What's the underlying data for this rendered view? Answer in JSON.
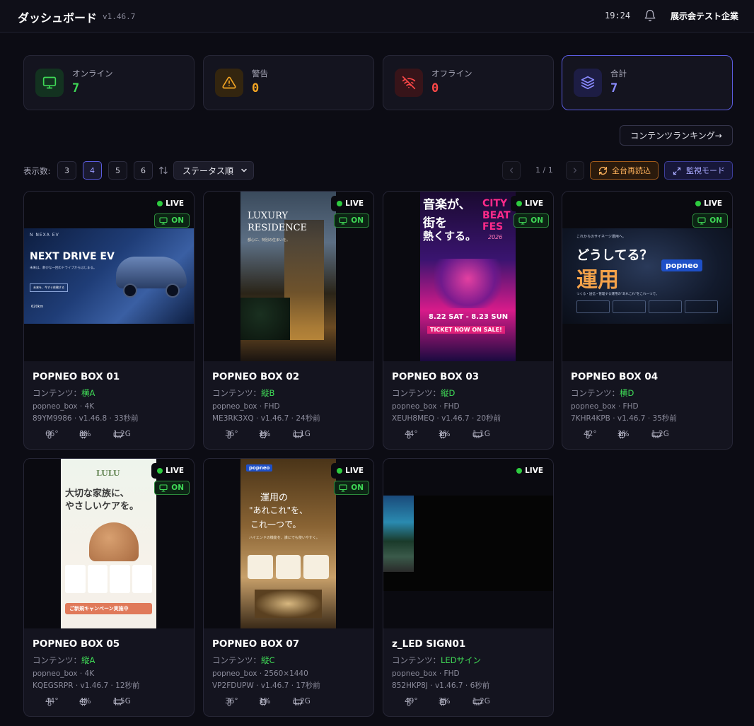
{
  "header": {
    "title": "ダッシュボード",
    "version": "v1.46.7",
    "time": "19:24",
    "org": "展示会テスト企業"
  },
  "stats": [
    {
      "label": "オンライン",
      "value": "7",
      "color": "#3fd956",
      "icon": "monitor-icon"
    },
    {
      "label": "警告",
      "value": "0",
      "color": "#f5a623",
      "icon": "warning-icon"
    },
    {
      "label": "オフライン",
      "value": "0",
      "color": "#ff4848",
      "icon": "wifi-off-icon"
    },
    {
      "label": "合計",
      "value": "7",
      "color": "#8a8bff",
      "icon": "layers-icon"
    }
  ],
  "ranking_button": "コンテンツランキング→",
  "controls": {
    "display_count_label": "表示数:",
    "counts": [
      "3",
      "4",
      "5",
      "6"
    ],
    "selected_count": "4",
    "sort_value": "ステータス順",
    "page": "1 / 1",
    "reload_label": "全台再読込",
    "monitor_label": "監視モード"
  },
  "status": {
    "live": "LIVE",
    "on": "ON"
  },
  "content_prefix": "コンテンツ：",
  "devices": [
    {
      "name": "POPNEO BOX 01",
      "content": "横A",
      "model": "popneo_box",
      "resolution": "4K",
      "serial": "89YM9986",
      "version": "v1.46.8",
      "last_seen": "33秒前",
      "temp": "66°",
      "cpu": "8%",
      "mem": "1.2G",
      "on": true,
      "poster": {
        "brand": "N NEXA EV",
        "headline": "NEXT DRIVE EV",
        "sub": "未来は、静かな一回のドライブからはじまる。",
        "cta": "未来を、今すぐ体験する",
        "spec": "620km"
      }
    },
    {
      "name": "POPNEO BOX 02",
      "content": "縦B",
      "model": "popneo_box",
      "resolution": "FHD",
      "serial": "ME3RK3XQ",
      "version": "v1.46.7",
      "last_seen": "24秒前",
      "temp": "36°",
      "cpu": "1%",
      "mem": "1.1G",
      "on": true,
      "poster": {
        "line1": "LUXURY",
        "line2": "RESIDENCE",
        "sub": "都心に、特別の住まいを。"
      }
    },
    {
      "name": "POPNEO BOX 03",
      "content": "縦D",
      "model": "popneo_box",
      "resolution": "FHD",
      "serial": "XEUH8MEQ",
      "version": "v1.46.7",
      "last_seen": "20秒前",
      "temp": "44°",
      "cpu": "1%",
      "mem": "1.1G",
      "on": true,
      "poster": {
        "jp1": "音楽が、",
        "jp2": "街を",
        "jp3": "熱くする。",
        "city1": "CITY",
        "city2": "BEAT",
        "city3": "FES",
        "year": "2026",
        "dates": "8.22 SAT - 8.23 SUN",
        "ticket": "TICKET NOW ON SALE!"
      }
    },
    {
      "name": "POPNEO BOX 04",
      "content": "横D",
      "model": "popneo_box",
      "resolution": "FHD",
      "serial": "7KHR4KPB",
      "version": "v1.46.7",
      "last_seen": "35秒前",
      "temp": "42°",
      "cpu": "1%",
      "mem": "1.2G",
      "on": true,
      "poster": {
        "top": "これからのサイネージ運用へ。",
        "q": "どうしてる？",
        "big": "運用",
        "logo": "popneo",
        "sub": "つくる・送信・管理する運用の\"あれこれ\"をこれ一つで。"
      }
    },
    {
      "name": "POPNEO BOX 05",
      "content": "縦A",
      "model": "popneo_box",
      "resolution": "4K",
      "serial": "KQEGSRPR",
      "version": "v1.46.7",
      "last_seen": "12秒前",
      "temp": "44°",
      "cpu": "4%",
      "mem": "1.5G",
      "on": true,
      "poster": {
        "brand": "LULU",
        "l1": "大切な家族に、",
        "l2": "やさしいケアを。",
        "campaign": "ご新規キャンペーン実施中"
      }
    },
    {
      "name": "POPNEO BOX 07",
      "content": "縦C",
      "model": "popneo_box",
      "resolution": "2560×1440",
      "serial": "VP2FDUPW",
      "version": "v1.46.7",
      "last_seen": "17秒前",
      "temp": "36°",
      "cpu": "1%",
      "mem": "1.2G",
      "on": true,
      "poster": {
        "logo": "popneo",
        "l1": "運用の",
        "l2": "\"あれこれ\"を、",
        "l3": "これ一つで。",
        "sub": "ハイエンドの機能を、誰にでも使いやすく。"
      }
    },
    {
      "name": "z_LED SIGN01",
      "content": "LEDサイン",
      "model": "popneo_box",
      "resolution": "FHD",
      "serial": "852HKP8J",
      "version": "v1.46.7",
      "last_seen": "6秒前",
      "temp": "49°",
      "cpu": "3%",
      "mem": "1.2G",
      "on": false,
      "poster": {}
    }
  ]
}
